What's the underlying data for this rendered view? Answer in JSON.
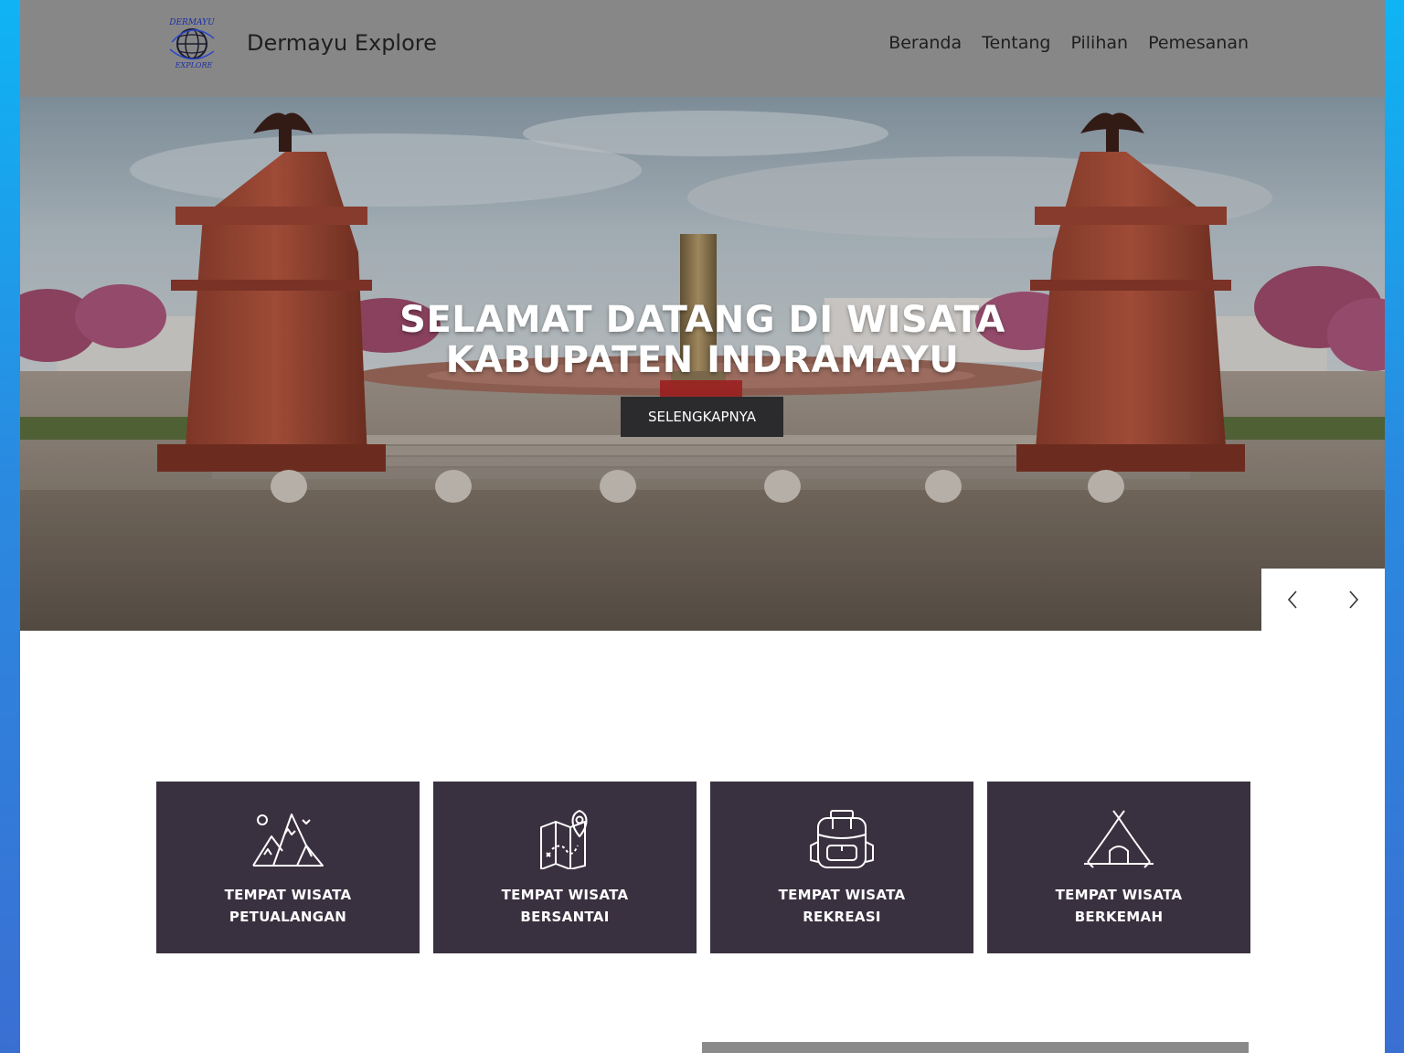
{
  "header": {
    "brand": "Dermayu Explore",
    "logo_text_top": "DERMAYU",
    "logo_text_bottom": "EXPLORE",
    "nav": [
      {
        "label": "Beranda"
      },
      {
        "label": "Tentang"
      },
      {
        "label": "Pilihan"
      },
      {
        "label": "Pemesanan"
      }
    ]
  },
  "hero": {
    "title_line1": "SELAMAT DATANG DI WISATA",
    "title_line2": "KABUPATEN INDRAMAYU",
    "button_label": "SELENGKAPNYA",
    "prev_icon": "chevron-left-icon",
    "next_icon": "chevron-right-icon"
  },
  "categories": [
    {
      "icon": "mountains-icon",
      "line1": "TEMPAT WISATA",
      "line2": "PETUALANGAN"
    },
    {
      "icon": "map-pin-icon",
      "line1": "TEMPAT WISATA",
      "line2": "BERSANTAI"
    },
    {
      "icon": "backpack-icon",
      "line1": "TEMPAT WISATA",
      "line2": "REKREASI"
    },
    {
      "icon": "tent-icon",
      "line1": "TEMPAT WISATA",
      "line2": "BERKEMAH"
    }
  ],
  "colors": {
    "header_bg": "#878787",
    "card_bg": "#3a3140",
    "button_bg": "#2b2b2d",
    "frame_gradient_top": "#0fb4f5",
    "frame_gradient_bottom": "#3a6fd2"
  }
}
